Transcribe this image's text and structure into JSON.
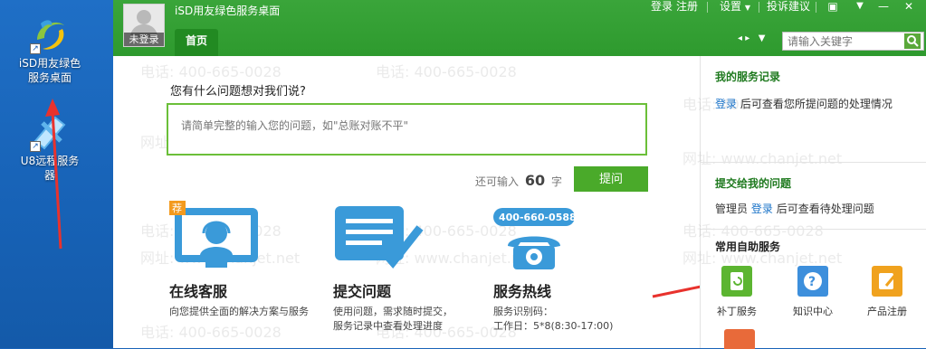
{
  "desktop": {
    "icons": [
      {
        "label_line1": "iSD用友绿色",
        "label_line2": "服务桌面",
        "icon": "isd-swirl-icon"
      },
      {
        "label_line1": "U8远程服务",
        "label_line2": "器",
        "icon": "u8-remote-icon"
      }
    ]
  },
  "window": {
    "title": "iSD用友绿色服务桌面",
    "user_status": "未登录",
    "home_tab": "首页",
    "menu": {
      "login": "登录",
      "register": "注册",
      "settings": "设置",
      "feedback": "投诉建议"
    },
    "search_placeholder": "请输入关键字"
  },
  "main": {
    "question_title": "您有什么问题想对我们说?",
    "question_placeholder": "请简单完整的输入您的问题，如\"总账对账不平\"",
    "remain_prefix": "还可输入",
    "remain_count": "60",
    "remain_suffix": "字",
    "submit_label": "提问",
    "features": [
      {
        "title": "在线客服",
        "badge": "荐",
        "desc1": "向您提供全面的解决方案与服务",
        "desc2": "",
        "icon": "headset-agent-icon"
      },
      {
        "title": "提交问题",
        "desc1": "使用问题，需求随时提交，",
        "desc2": "服务记录中查看处理进度",
        "icon": "document-check-icon"
      },
      {
        "title": "服务热线",
        "phone": "400-660-0588",
        "desc1": "服务识别码：",
        "desc2": "工作日：5*8(8:30-17:00)",
        "icon": "telephone-icon"
      }
    ]
  },
  "sidebar": {
    "records_title": "我的服务记录",
    "records_link": "登录",
    "records_text": "后可查看您所提问题的处理情况",
    "assigned_title": "提交给我的问题",
    "assigned_prefix": "管理员",
    "assigned_link": "登录",
    "assigned_text": "后可查看待处理问题",
    "selfhelp_title": "常用自助服务",
    "services": [
      {
        "label": "补丁服务",
        "color": "#5cb531",
        "icon": "patch-icon"
      },
      {
        "label": "知识中心",
        "color": "#3d8fdc",
        "icon": "question-icon"
      },
      {
        "label": "产品注册",
        "color": "#f0a21e",
        "icon": "edit-icon"
      }
    ]
  },
  "watermarks": {
    "phone": "电话: 400-665-0028",
    "site": "网址: www.chanjet.net"
  }
}
